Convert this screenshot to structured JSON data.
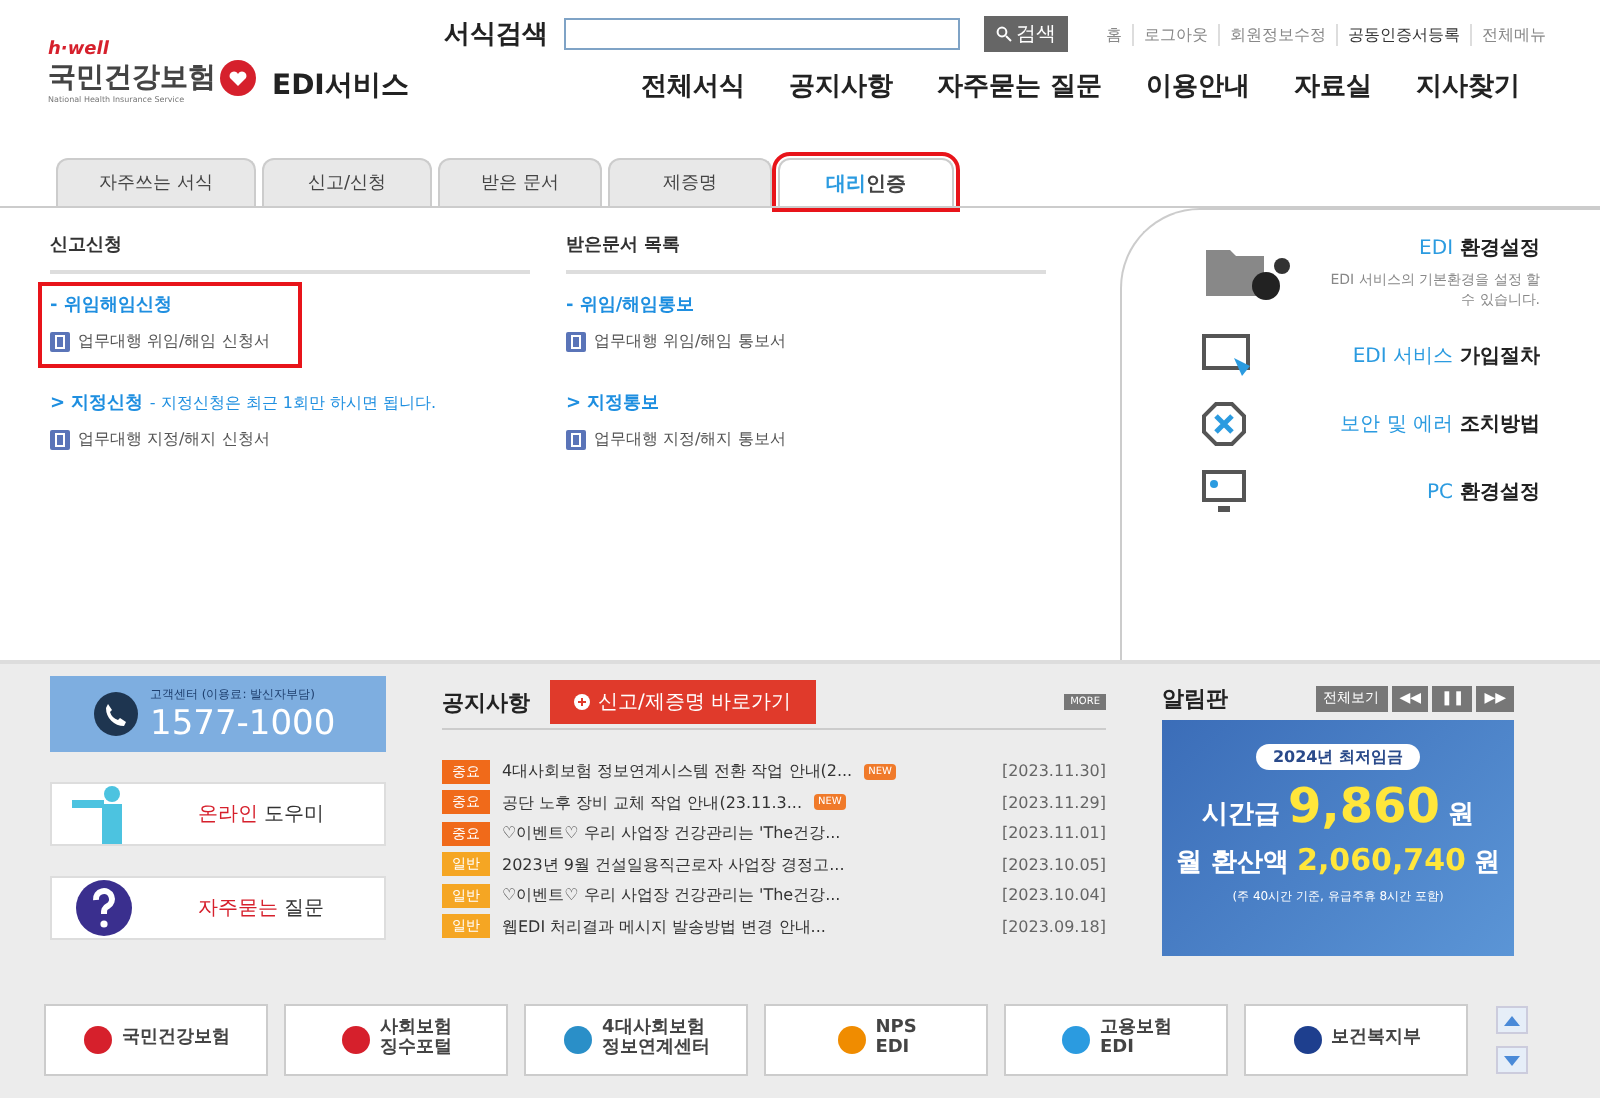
{
  "header": {
    "logo": {
      "tagline": "h·well",
      "name": "국민건강보험",
      "subtitle": "National Health Insurance Service",
      "service": "EDI서비스"
    },
    "search": {
      "label": "서식검색",
      "button": "검색"
    },
    "utility_links": [
      "홈",
      "로그아웃",
      "회원정보수정",
      "공동인증서등록",
      "전체메뉴"
    ],
    "nav": [
      "전체서식",
      "공지사항",
      "자주묻는 질문",
      "이용안내",
      "자료실",
      "지사찾기"
    ]
  },
  "tabs": [
    {
      "label": "자주쓰는 서식",
      "selected": false,
      "highlighted": false
    },
    {
      "label": "신고/신청",
      "selected": false,
      "highlighted": false
    },
    {
      "label": "받은 문서",
      "selected": false,
      "highlighted": false
    },
    {
      "label": "제증명",
      "selected": false,
      "highlighted": false
    },
    {
      "label_accent": "대리",
      "label": "인증",
      "selected": true,
      "highlighted": true
    }
  ],
  "panel": {
    "columns": [
      {
        "title": "신고신청",
        "groups": [
          {
            "heading": "- 위임해임신청",
            "highlighted": true,
            "forms": [
              "업무대행 위임/해임 신청서"
            ]
          },
          {
            "heading": "> 지정신청",
            "note": "- 지정신청은 최근 1회만 하시면 됩니다.",
            "highlighted": false,
            "forms": [
              "업무대행 지정/해지 신청서"
            ]
          }
        ]
      },
      {
        "title": "받은문서 목록",
        "groups": [
          {
            "heading": "- 위임/해임통보",
            "highlighted": false,
            "forms": [
              "업무대행 위임/해임 통보서"
            ]
          },
          {
            "heading": "> 지정통보",
            "highlighted": false,
            "forms": [
              "업무대행 지정/해지 통보서"
            ]
          }
        ]
      }
    ],
    "shortcuts": [
      {
        "kind": "settings",
        "accent": "EDI",
        "label": "환경설정",
        "description": "EDI 서비스의 기본환경을 설정 할 수 있습니다."
      },
      {
        "kind": "join",
        "accent": "EDI 서비스",
        "label": "가입절차"
      },
      {
        "kind": "error",
        "accent": "보안 및 에러",
        "label": "조치방법"
      },
      {
        "kind": "pc",
        "accent": "PC",
        "label": "환경설정"
      }
    ]
  },
  "sidebar": {
    "call_center": {
      "caption": "고객센터 (이용료: 발신자부담)",
      "number": "1577-1000"
    },
    "links": [
      {
        "kind": "help",
        "accent": "온라인",
        "label": "도우미"
      },
      {
        "kind": "faq",
        "accent": "자주묻는",
        "label": "질문"
      }
    ]
  },
  "notices": {
    "title": "공지사항",
    "shortcut": "신고/제증명 바로가기",
    "more": "MORE",
    "rows": [
      {
        "kind": "important",
        "badge": "중요",
        "title": "4대사회보험 정보연계시스템 전환 작업 안내(2...",
        "new_label": "NEW",
        "date": "[2023.11.30]"
      },
      {
        "kind": "important",
        "badge": "중요",
        "title": "공단 노후 장비 교체 작업 안내(23.11.3...",
        "new_label": "NEW",
        "date": "[2023.11.29]"
      },
      {
        "kind": "important",
        "badge": "중요",
        "title": "♡이벤트♡ 우리 사업장 건강관리는 'The건강...",
        "date": "[2023.11.01]"
      },
      {
        "kind": "general",
        "badge": "일반",
        "title": "2023년 9월 건설일용직근로자 사업장 경정고...",
        "date": "[2023.10.05]"
      },
      {
        "kind": "general",
        "badge": "일반",
        "title": "♡이벤트♡ 우리 사업장 건강관리는 'The건강...",
        "date": "[2023.10.04]"
      },
      {
        "kind": "general",
        "badge": "일반",
        "title": "웹EDI 처리결과 메시지 발송방법 변경 안내...",
        "date": "[2023.09.18]"
      }
    ]
  },
  "board": {
    "title": "알림판",
    "view_all": "전체보기",
    "controls": [
      "◀◀",
      "❚❚",
      "▶▶"
    ],
    "banner": {
      "headline": "2024년 최저임금",
      "hourly_label": "시간급",
      "hourly": "9,860",
      "hourly_unit": "원",
      "monthly_label": "월 환산액",
      "monthly": "2,060,740",
      "monthly_unit": "원",
      "note": "(주 40시간 기준, 유급주휴 8시간 포함)"
    }
  },
  "footer_logos": [
    {
      "kind": "nhis",
      "lines": [
        "국민건강보험"
      ]
    },
    {
      "kind": "nhis",
      "lines": [
        "사회보험",
        "징수포털"
      ]
    },
    {
      "kind": "link",
      "lines": [
        "4대사회보험",
        "정보연계센터"
      ]
    },
    {
      "kind": "nps",
      "lines": [
        "NPS",
        "EDI"
      ]
    },
    {
      "kind": "ei",
      "lines": [
        "고용보험",
        "EDI"
      ]
    },
    {
      "kind": "mohw",
      "lines": [
        "보건복지부"
      ]
    }
  ]
}
